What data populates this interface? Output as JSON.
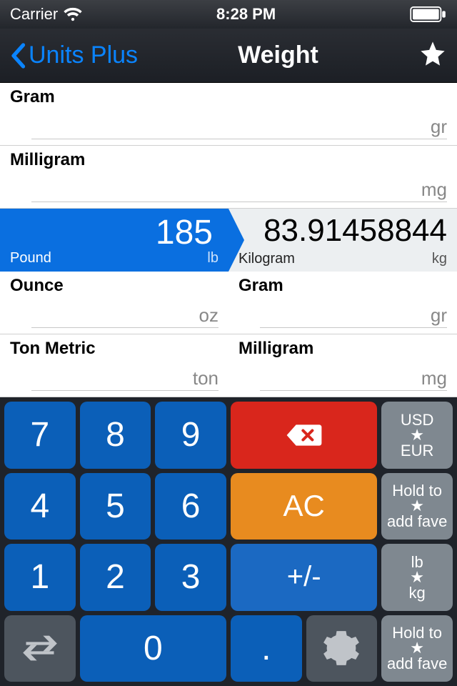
{
  "statusbar": {
    "carrier": "Carrier",
    "time": "8:28 PM"
  },
  "nav": {
    "back": "Units Plus",
    "title": "Weight"
  },
  "rows": [
    {
      "full": true,
      "left": {
        "name": "Gram",
        "abbr": "gr",
        "value": ""
      }
    },
    {
      "full": true,
      "left": {
        "name": "Milligram",
        "abbr": "mg",
        "value": ""
      }
    },
    {
      "active": true,
      "left": {
        "name": "Pound",
        "abbr": "lb",
        "value": "185"
      },
      "right": {
        "name": "Kilogram",
        "abbr": "kg",
        "value": "83.91458844"
      }
    },
    {
      "left": {
        "name": "Ounce",
        "abbr": "oz",
        "value": ""
      },
      "right": {
        "name": "Gram",
        "abbr": "gr",
        "value": ""
      }
    },
    {
      "left": {
        "name": "Ton Metric",
        "abbr": "ton",
        "value": ""
      },
      "right": {
        "name": "Milligram",
        "abbr": "mg",
        "value": ""
      }
    }
  ],
  "keys": {
    "d7": "7",
    "d8": "8",
    "d9": "9",
    "d4": "4",
    "d5": "5",
    "d6": "6",
    "d1": "1",
    "d2": "2",
    "d3": "3",
    "d0": "0",
    "dot": ".",
    "ac": "AC",
    "pm": "+/-",
    "fav1a": "USD",
    "fav1b": "EUR",
    "fav2": "Hold to",
    "fav2b": "add fave",
    "fav3a": "lb",
    "fav3b": "kg",
    "fav4": "Hold to",
    "fav4b": "add fave",
    "star": "★"
  }
}
